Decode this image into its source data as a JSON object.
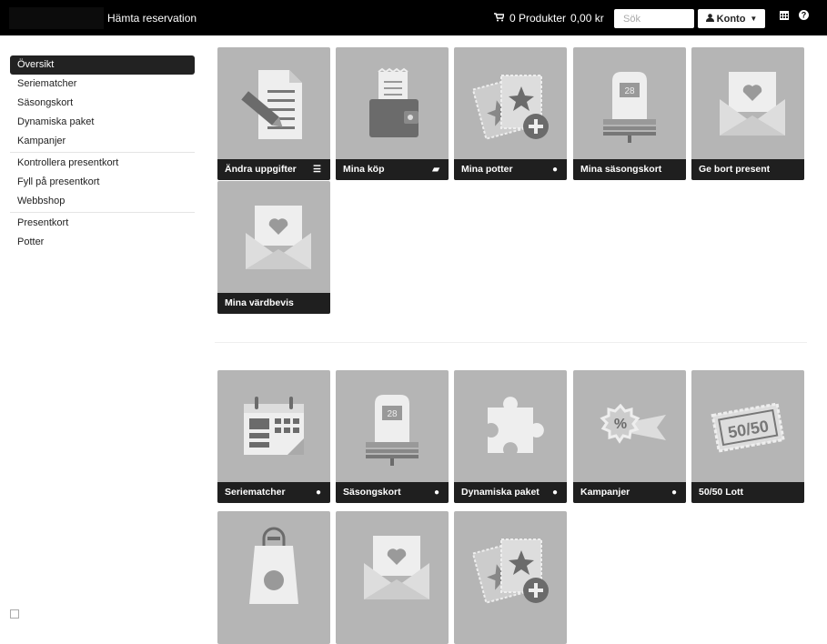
{
  "topbar": {
    "fetch_label": "Hämta reservation",
    "cart_icon": "cart-icon",
    "cart_count": "0 Produkter",
    "cart_total": "0,00 kr",
    "search_placeholder": "Sök",
    "account_label": "Konto",
    "calendar_icon": "calendar-icon",
    "help_icon": "help-icon"
  },
  "sidebar": {
    "items": [
      {
        "label": "Översikt",
        "active": true
      },
      {
        "label": "Seriematcher"
      },
      {
        "label": "Säsongskort"
      },
      {
        "label": "Dynamiska paket"
      },
      {
        "label": "Kampanjer"
      },
      {
        "label": "Kontrollera presentkort"
      },
      {
        "label": "Fyll på presentkort"
      },
      {
        "label": "Webbshop"
      },
      {
        "label": "Presentkort"
      },
      {
        "label": "Potter"
      }
    ]
  },
  "tiles_top": [
    {
      "label": "Ändra uppgifter",
      "icon": "edit-document-icon",
      "caption_icon": "list-icon"
    },
    {
      "label": "Mina köp",
      "icon": "wallet-receipt-icon",
      "caption_icon": "folder-open-icon"
    },
    {
      "label": "Mina potter",
      "icon": "tickets-add-icon",
      "caption_icon": "info-circle-icon"
    },
    {
      "label": "Mina säsongskort",
      "icon": "seat-calendar-icon",
      "caption_icon": ""
    },
    {
      "label": "Ge bort present",
      "icon": "envelope-heart-icon",
      "caption_icon": ""
    },
    {
      "label": "Mina värdbevis",
      "icon": "envelope-heart-icon",
      "caption_icon": ""
    }
  ],
  "tiles_bottom": [
    {
      "label": "Seriematcher",
      "icon": "calendar-grid-icon",
      "caption_icon": "info-circle-icon"
    },
    {
      "label": "Säsongskort",
      "icon": "seat-calendar-icon",
      "caption_icon": "info-circle-icon"
    },
    {
      "label": "Dynamiska paket",
      "icon": "puzzle-piece-icon",
      "caption_icon": "info-circle-icon"
    },
    {
      "label": "Kampanjer",
      "icon": "percent-badge-icon",
      "caption_icon": "info-circle-icon"
    },
    {
      "label": "50/50 Lott",
      "icon": "lottery-ticket-icon",
      "caption_icon": ""
    },
    {
      "label": "",
      "icon": "shopping-bag-icon",
      "caption_icon": ""
    },
    {
      "label": "",
      "icon": "envelope-heart-icon",
      "caption_icon": ""
    },
    {
      "label": "",
      "icon": "tickets-add-icon",
      "caption_icon": ""
    }
  ],
  "icon_texts": {
    "calendar_day": "28",
    "lottery_text": "50/50",
    "percent": "%"
  },
  "colors": {
    "topbar_bg": "#000000",
    "tile_bg": "#b5b5b5",
    "caption_bg": "#1f1f1f",
    "icon_light": "#eeeeee",
    "icon_dark": "#6b6b6b"
  }
}
